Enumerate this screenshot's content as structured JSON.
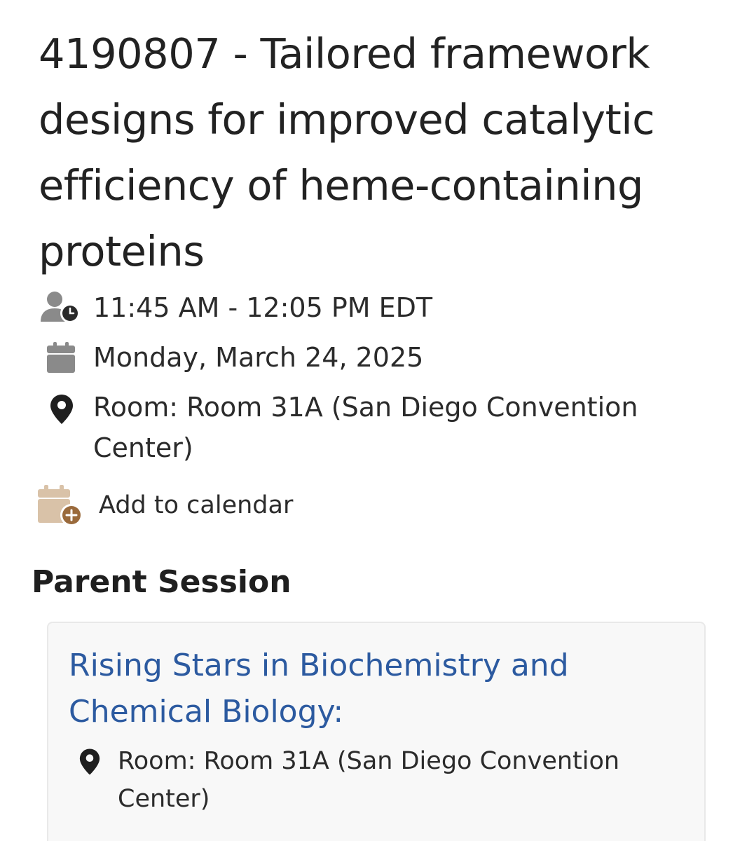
{
  "event": {
    "title": "4190807 - Tailored framework designs for improved catalytic efficiency of heme-containing proteins",
    "time": "11:45 AM - 12:05 PM EDT",
    "date": "Monday, March 24, 2025",
    "location": "Room: Room 31A (San Diego Convention Center)",
    "add_to_calendar_label": "Add to calendar"
  },
  "parent_session": {
    "heading": "Parent Session",
    "title": "Rising Stars in Biochemistry and Chemical Biology:",
    "location": "Room: Room 31A (San Diego Convention Center)"
  },
  "icons": {
    "time": "person-clock-icon",
    "date": "calendar-icon",
    "location": "map-pin-icon",
    "add_calendar": "calendar-plus-icon"
  },
  "colors": {
    "text": "#222222",
    "link": "#2c5aa0",
    "icon_gray": "#8a8a8a",
    "pin_dark": "#1f1f1f",
    "calendar_tan": "#d9c2a8",
    "calendar_brown": "#9a6a3c",
    "card_bg": "#f8f8f8",
    "card_border": "#e9e9e9"
  }
}
